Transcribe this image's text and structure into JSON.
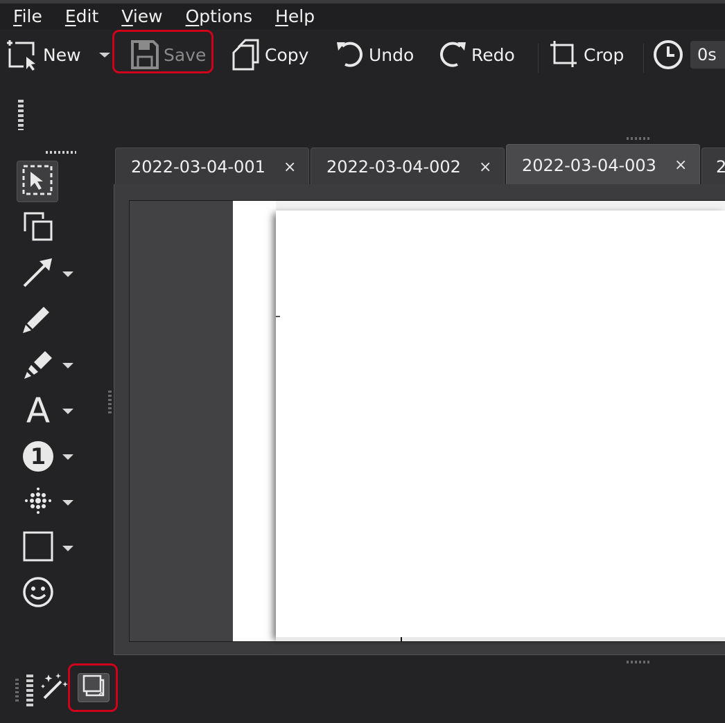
{
  "menubar": {
    "items": [
      {
        "underline": "F",
        "rest": "ile"
      },
      {
        "underline": "E",
        "rest": "dit"
      },
      {
        "underline": "V",
        "rest": "iew"
      },
      {
        "underline": "O",
        "rest": "ptions"
      },
      {
        "underline": "H",
        "rest": "elp"
      }
    ]
  },
  "toolbar": {
    "new_label": "New",
    "save_label": "Save",
    "copy_label": "Copy",
    "undo_label": "Undo",
    "redo_label": "Redo",
    "crop_label": "Crop",
    "delay_value": "0s"
  },
  "tools": [
    {
      "icon": "select-icon",
      "active": true
    },
    {
      "icon": "duplicate-icon"
    },
    {
      "icon": "arrow-icon",
      "has_menu": true
    },
    {
      "icon": "pen-icon"
    },
    {
      "icon": "marker-icon",
      "has_menu": true
    },
    {
      "icon": "text-icon",
      "has_menu": true,
      "glyph": "A"
    },
    {
      "icon": "number-icon",
      "has_menu": true,
      "glyph": "1"
    },
    {
      "icon": "blur-icon",
      "has_menu": true
    },
    {
      "icon": "rectangle-icon",
      "has_menu": true
    },
    {
      "icon": "sticker-icon"
    }
  ],
  "tabs": [
    {
      "label": "2022-03-04-001",
      "close": "×"
    },
    {
      "label": "2022-03-04-002",
      "close": "×"
    },
    {
      "label": "2022-03-04-003",
      "close": "×",
      "active": true
    },
    {
      "label": "2"
    }
  ],
  "colors": {
    "highlight": "#d0021b",
    "background": "#232325",
    "page": "#ffffff"
  }
}
